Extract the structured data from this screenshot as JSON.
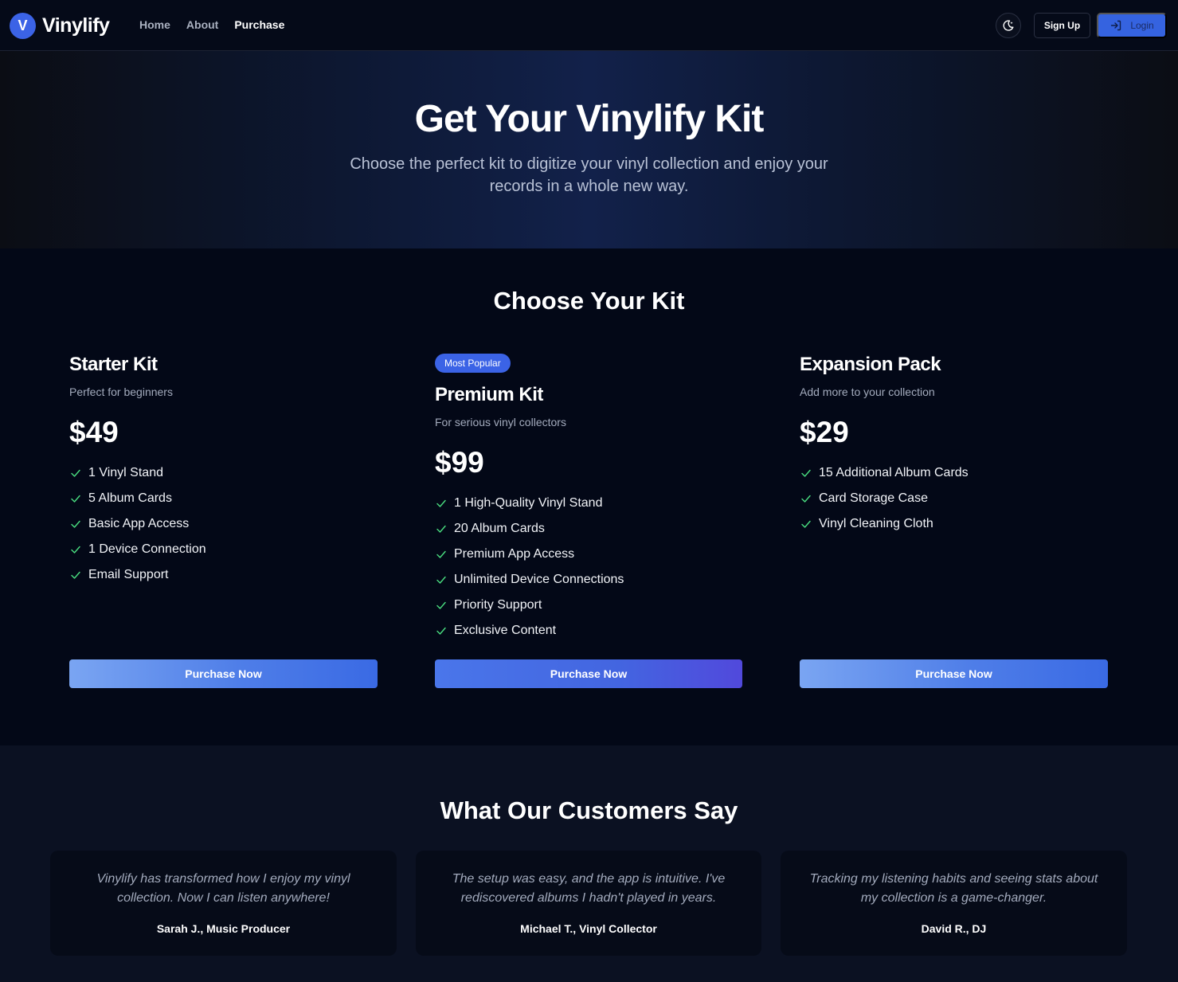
{
  "brand": {
    "logo_letter": "V",
    "name": "Vinylify",
    "accent": "#3b63e6"
  },
  "nav": {
    "links": [
      {
        "label": "Home"
      },
      {
        "label": "About"
      },
      {
        "label": "Purchase"
      }
    ],
    "active": "Purchase",
    "theme_icon": "moon-icon",
    "signup_label": "Sign Up",
    "login_label": "Login",
    "login_icon": "login-arrow-icon"
  },
  "hero": {
    "title": "Get Your Vinylify Kit",
    "subtitle": "Choose the perfect kit to digitize your vinyl collection and enjoy your records in a whole new way."
  },
  "kits": {
    "section_title": "Choose Your Kit",
    "items": [
      {
        "name": "Starter Kit",
        "description": "Perfect for beginners",
        "price": "$49",
        "features": [
          "1 Vinyl Stand",
          "5 Album Cards",
          "Basic App Access",
          "1 Device Connection",
          "Email Support"
        ],
        "button": "Purchase Now"
      },
      {
        "badge": "Most Popular",
        "name": "Premium Kit",
        "description": "For serious vinyl collectors",
        "price": "$99",
        "features": [
          "1 High-Quality Vinyl Stand",
          "20 Album Cards",
          "Premium App Access",
          "Unlimited Device Connections",
          "Priority Support",
          "Exclusive Content"
        ],
        "button": "Purchase Now"
      },
      {
        "name": "Expansion Pack",
        "description": "Add more to your collection",
        "price": "$29",
        "features": [
          "15 Additional Album Cards",
          "Card Storage Case",
          "Vinyl Cleaning Cloth"
        ],
        "button": "Purchase Now"
      }
    ],
    "check_color": "#4ade80"
  },
  "testimonials": {
    "section_title": "What Our Customers Say",
    "items": [
      {
        "quote": "Vinylify has transformed how I enjoy my vinyl collection. Now I can listen anywhere!",
        "author": "Sarah J., Music Producer"
      },
      {
        "quote": "The setup was easy, and the app is intuitive. I've rediscovered albums I hadn't played in years.",
        "author": "Michael T., Vinyl Collector"
      },
      {
        "quote": "Tracking my listening habits and seeing stats about my collection is a game-changer.",
        "author": "David R., DJ"
      }
    ]
  }
}
